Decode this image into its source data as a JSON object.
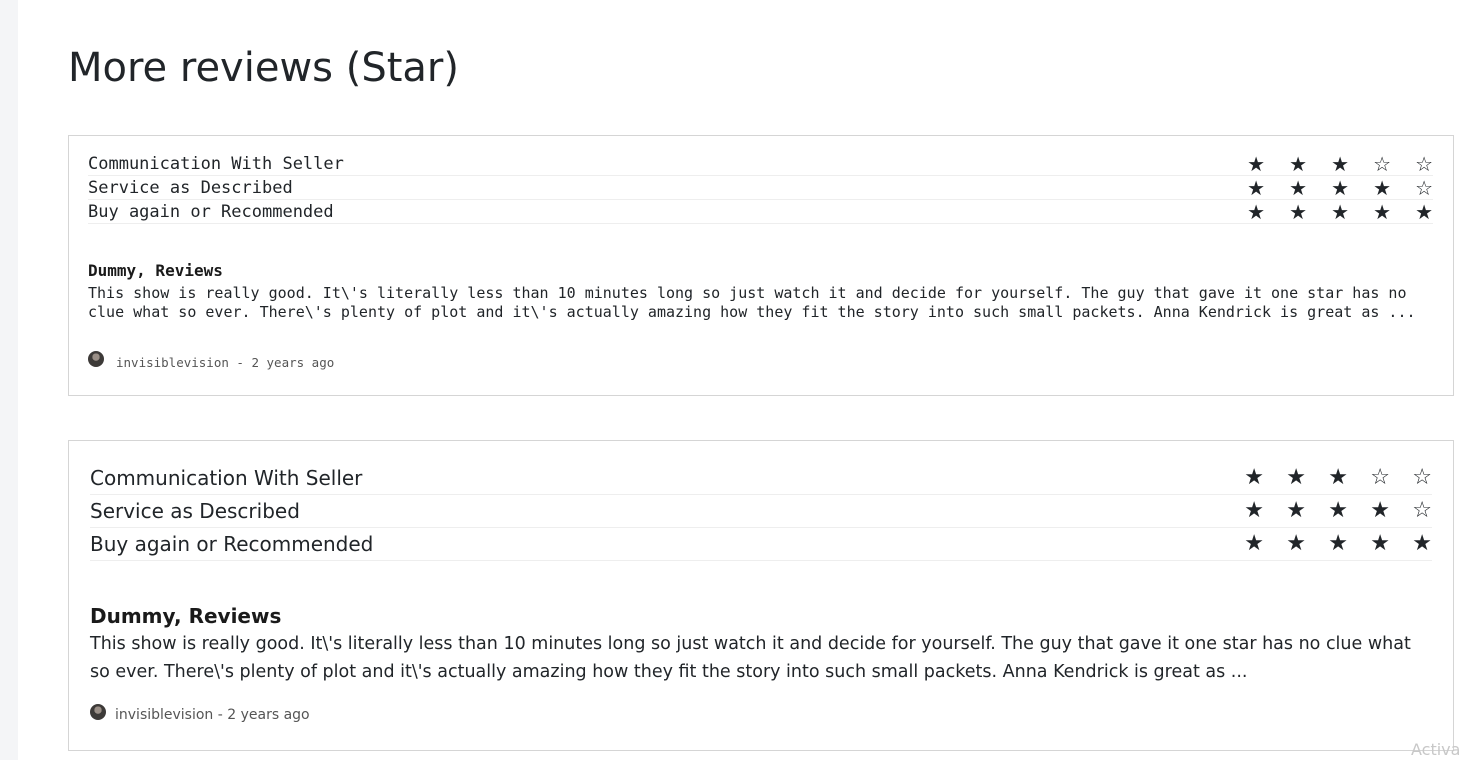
{
  "page": {
    "title": "More reviews (Star)"
  },
  "reviews": [
    {
      "ratings": [
        {
          "label": "Communication With Seller",
          "score": 3,
          "max": 5
        },
        {
          "label": "Service as Described",
          "score": 4,
          "max": 5
        },
        {
          "label": "Buy again or Recommended",
          "score": 5,
          "max": 5
        }
      ],
      "title": "Dummy, Reviews",
      "body": "This show is really good. It\\'s literally less than 10 minutes long so just watch it and decide for yourself. The guy that gave it one star has no clue what so ever. There\\'s plenty of plot and it\\'s actually amazing how they fit the story into such small packets. Anna Kendrick is great as ...",
      "meta": "invisiblevision - 2 years ago"
    },
    {
      "ratings": [
        {
          "label": "Communication With Seller",
          "score": 3,
          "max": 5
        },
        {
          "label": "Service as Described",
          "score": 4,
          "max": 5
        },
        {
          "label": "Buy again or Recommended",
          "score": 5,
          "max": 5
        }
      ],
      "title": "Dummy, Reviews",
      "body": "This show is really good. It\\'s literally less than 10 minutes long so just watch it and decide for yourself. The guy that gave it one star has no clue what so ever. There\\'s plenty of plot and it\\'s actually amazing how they fit the story into such small packets. Anna Kendrick is great as ...",
      "meta": "invisiblevision - 2 years ago"
    }
  ],
  "icons": {
    "star_filled": "star-filled-icon",
    "star_empty": "star-empty-icon",
    "avatar": "user-avatar"
  },
  "colors": {
    "text": "#212529",
    "border": "#d5d5d5",
    "star": "#212529"
  },
  "overlay": {
    "watermark": "Activa"
  }
}
